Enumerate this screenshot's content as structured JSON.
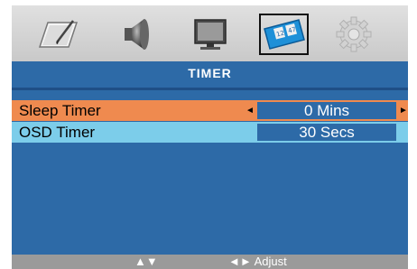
{
  "menu": {
    "tabs": [
      {
        "icon": "picture-icon"
      },
      {
        "icon": "sound-icon"
      },
      {
        "icon": "screen-icon"
      },
      {
        "icon": "timer-icon",
        "selected": true
      },
      {
        "icon": "setup-gear-icon"
      }
    ],
    "timer_icon_text": [
      "12",
      "47"
    ],
    "title": "TIMER",
    "rows": [
      {
        "label": "Sleep Timer",
        "value": "0 Mins",
        "highlighted": true,
        "left_arrow": "◄",
        "right_arrow": "►"
      },
      {
        "label": "OSD Timer",
        "value": "30 Secs",
        "highlighted": false
      }
    ],
    "footer": {
      "nav_hint": "▲▼",
      "adjust_hint": "◄► Adjust"
    }
  },
  "colors": {
    "background": "#2d6aa7",
    "selected_row": "#ef8a4f",
    "row": "#7ccdea",
    "footer": "#9a9a9a"
  }
}
